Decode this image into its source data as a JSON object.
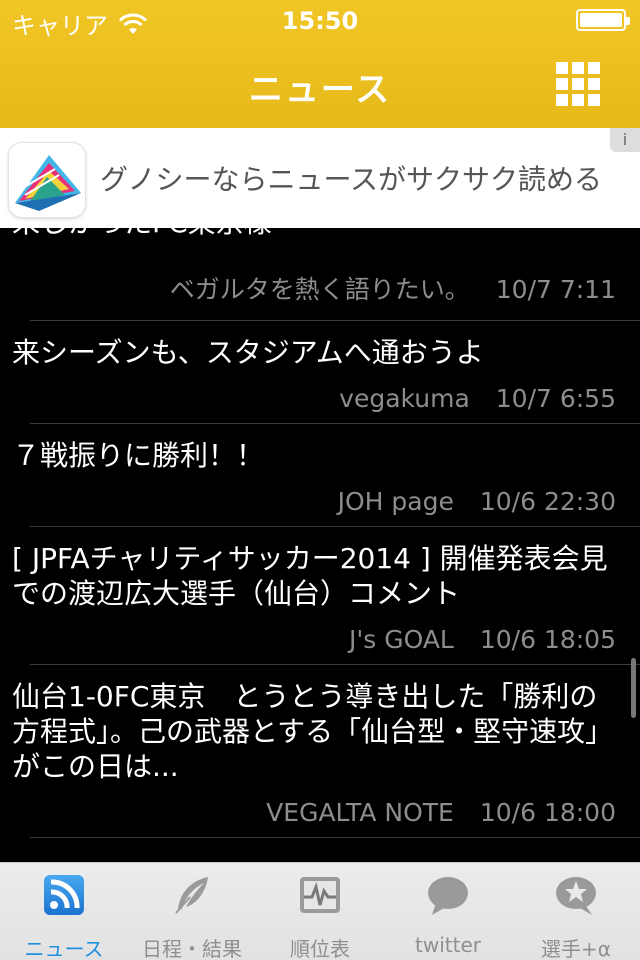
{
  "status": {
    "carrier": "キャリア",
    "time": "15:50"
  },
  "nav": {
    "title": "ニュース"
  },
  "ad": {
    "text": "グノシーならニュースがサクサク読める",
    "info": "i"
  },
  "news": [
    {
      "title": "来しかったFC東京様",
      "source": "ベガルタを熱く語りたい。",
      "date": "10/7 7:11"
    },
    {
      "title": "来シーズンも、スタジアムへ通おうよ",
      "source": "vegakuma",
      "date": "10/7 6:55"
    },
    {
      "title": "７戦振りに勝利！！",
      "source": "JOH page",
      "date": "10/6 22:30"
    },
    {
      "title": "[ JPFAチャリティサッカー2014 ] 開催発表会見での渡辺広大選手（仙台）コメント",
      "source": "J's GOAL",
      "date": "10/6 18:05"
    },
    {
      "title": "仙台1-0FC東京　とうとう導き出した「勝利の方程式」。己の武器とする「仙台型・堅守速攻」がこの日は...",
      "source": "VEGALTA NOTE",
      "date": "10/6 18:00"
    }
  ],
  "tabs": [
    {
      "label": "ニュース",
      "icon": "rss-icon",
      "active": true
    },
    {
      "label": "日程・結果",
      "icon": "feather-icon",
      "active": false
    },
    {
      "label": "順位表",
      "icon": "chart-icon",
      "active": false
    },
    {
      "label": "twitter",
      "icon": "speech-bubble-icon",
      "active": false
    },
    {
      "label": "選手+α",
      "icon": "star-bubble-icon",
      "active": false
    }
  ],
  "colors": {
    "accent": "#e8bc1e",
    "tab_active": "#1f8fe0",
    "tab_inactive": "#8f8f8f"
  }
}
